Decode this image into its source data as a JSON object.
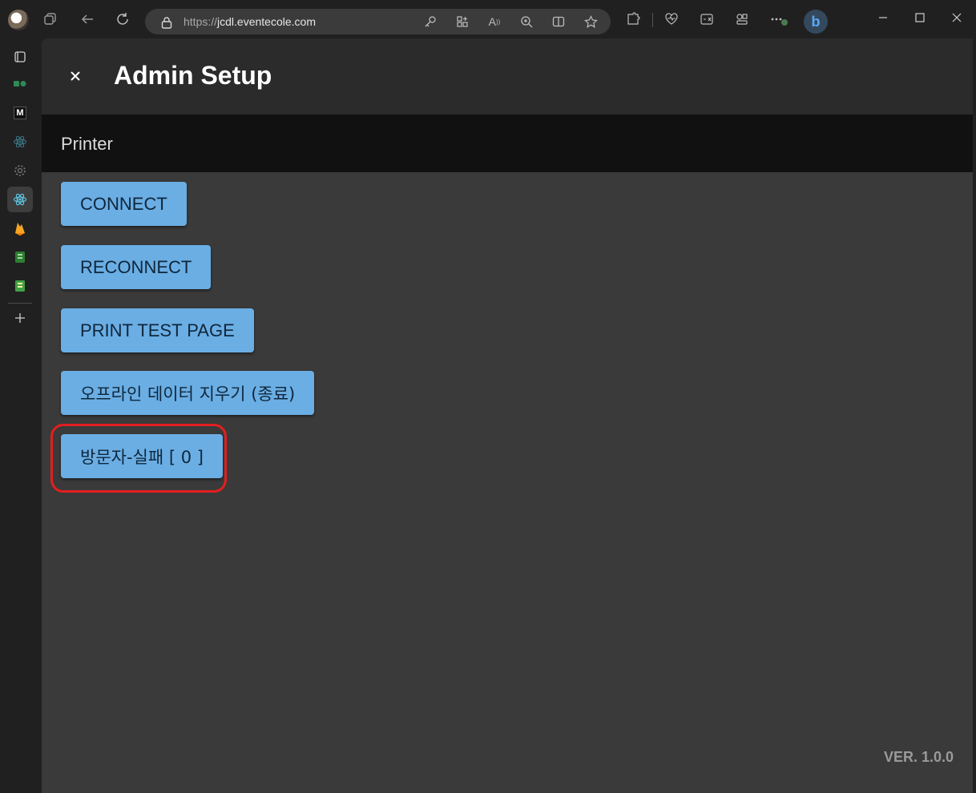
{
  "browser": {
    "url_prefix": "https://",
    "url_host": "jcdl.eventecole.com"
  },
  "icons": {
    "close": "close-icon",
    "tabs": "tab-actions-icon",
    "back": "back-icon",
    "refresh": "refresh-icon"
  },
  "colors": {
    "button_bg": "#6aaee4",
    "highlight": "#e21f1f",
    "page_bg": "#3a3a3a"
  },
  "app": {
    "title": "Admin Setup",
    "section": "Printer",
    "buttons": {
      "connect": "CONNECT",
      "reconnect": "RECONNECT",
      "print_test": "PRINT TEST PAGE",
      "clear_offline": "오프라인 데이터 지우기 (종료)",
      "visitor_fail": "방문자-실패 [ 0 ]"
    },
    "version": "VER. 1.0.0"
  }
}
